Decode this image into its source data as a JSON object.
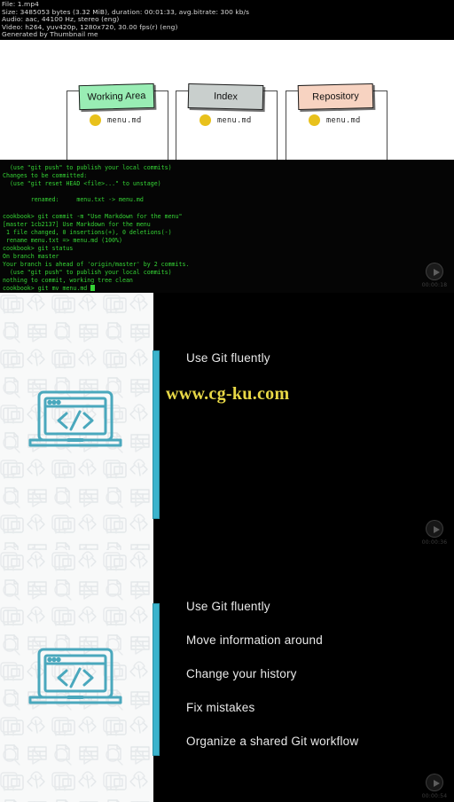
{
  "fileinfo": {
    "line1": "File: 1.mp4",
    "line2": "Size: 3485053 bytes (3.32 MiB), duration: 00:01:33, avg.bitrate: 300 kb/s",
    "line3": "Audio: aac, 44100 Hz, stereo (eng)",
    "line4": "Video: h264, yuv420p, 1280x720, 30.00 fps(r) (eng)",
    "line5": "Generated by Thumbnail me"
  },
  "diagram": {
    "areas": [
      {
        "label": "Working Area",
        "color": "#99edb4",
        "file": "menu.md"
      },
      {
        "label": "Index",
        "color": "#c9cfcd",
        "file": "menu.md"
      },
      {
        "label": "Repository",
        "color": "#f7d3c1",
        "file": "menu.md"
      }
    ]
  },
  "terminal": {
    "lines": [
      "  (use \"git push\" to publish your local commits)",
      "Changes to be committed:",
      "  (use \"git reset HEAD <file>...\" to unstage)",
      "",
      "        renamed:     menu.txt -> menu.md",
      "",
      "cookbook> git commit -m \"Use Markdown for the menu\"",
      "[master 1cb2137] Use Markdown for the menu",
      " 1 file changed, 0 insertions(+), 0 deletions(-)",
      " rename menu.txt => menu.md (100%)",
      "cookbook> git status",
      "On branch master",
      "Your branch is ahead of 'origin/master' by 2 commits.",
      "  (use \"git push\" to publish your local commits)",
      "nothing to commit, working tree clean"
    ],
    "prompt": "cookbook> git mv menu.md "
  },
  "slide2": {
    "headline": "Use Git fluently",
    "watermark": "www.cg-ku.com"
  },
  "slide3": {
    "bullets": [
      "Use Git fluently",
      "Move information around",
      "Change your history",
      "Fix mistakes",
      "Organize a shared Git workflow"
    ]
  },
  "overlays": [
    {
      "timestamp": "00:00:18"
    },
    {
      "timestamp": "00:00:36"
    },
    {
      "timestamp": "00:00:54"
    }
  ],
  "colors": {
    "accent": "#3bb3cc",
    "terminal_text": "#35d435",
    "watermark": "#e8d846",
    "file_dot": "#e8c11c"
  }
}
